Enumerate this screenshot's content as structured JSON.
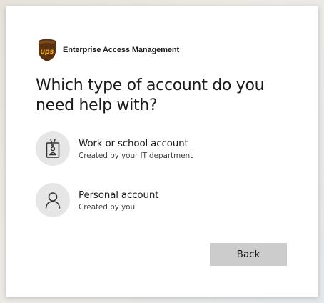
{
  "brand": {
    "logo_text": "ups",
    "name": "Enterprise Access Management"
  },
  "heading": "Which type of account do you need help with?",
  "options": [
    {
      "icon": "badge-icon",
      "title": "Work or school account",
      "subtitle": "Created by your IT department"
    },
    {
      "icon": "person-icon",
      "title": "Personal account",
      "subtitle": "Created by you"
    }
  ],
  "buttons": {
    "back_label": "Back"
  },
  "colors": {
    "ups_brown": "#5a3210",
    "ups_gold": "#f5b52a",
    "button_gray": "#cccccc",
    "icon_circle": "#e6e6e6"
  }
}
